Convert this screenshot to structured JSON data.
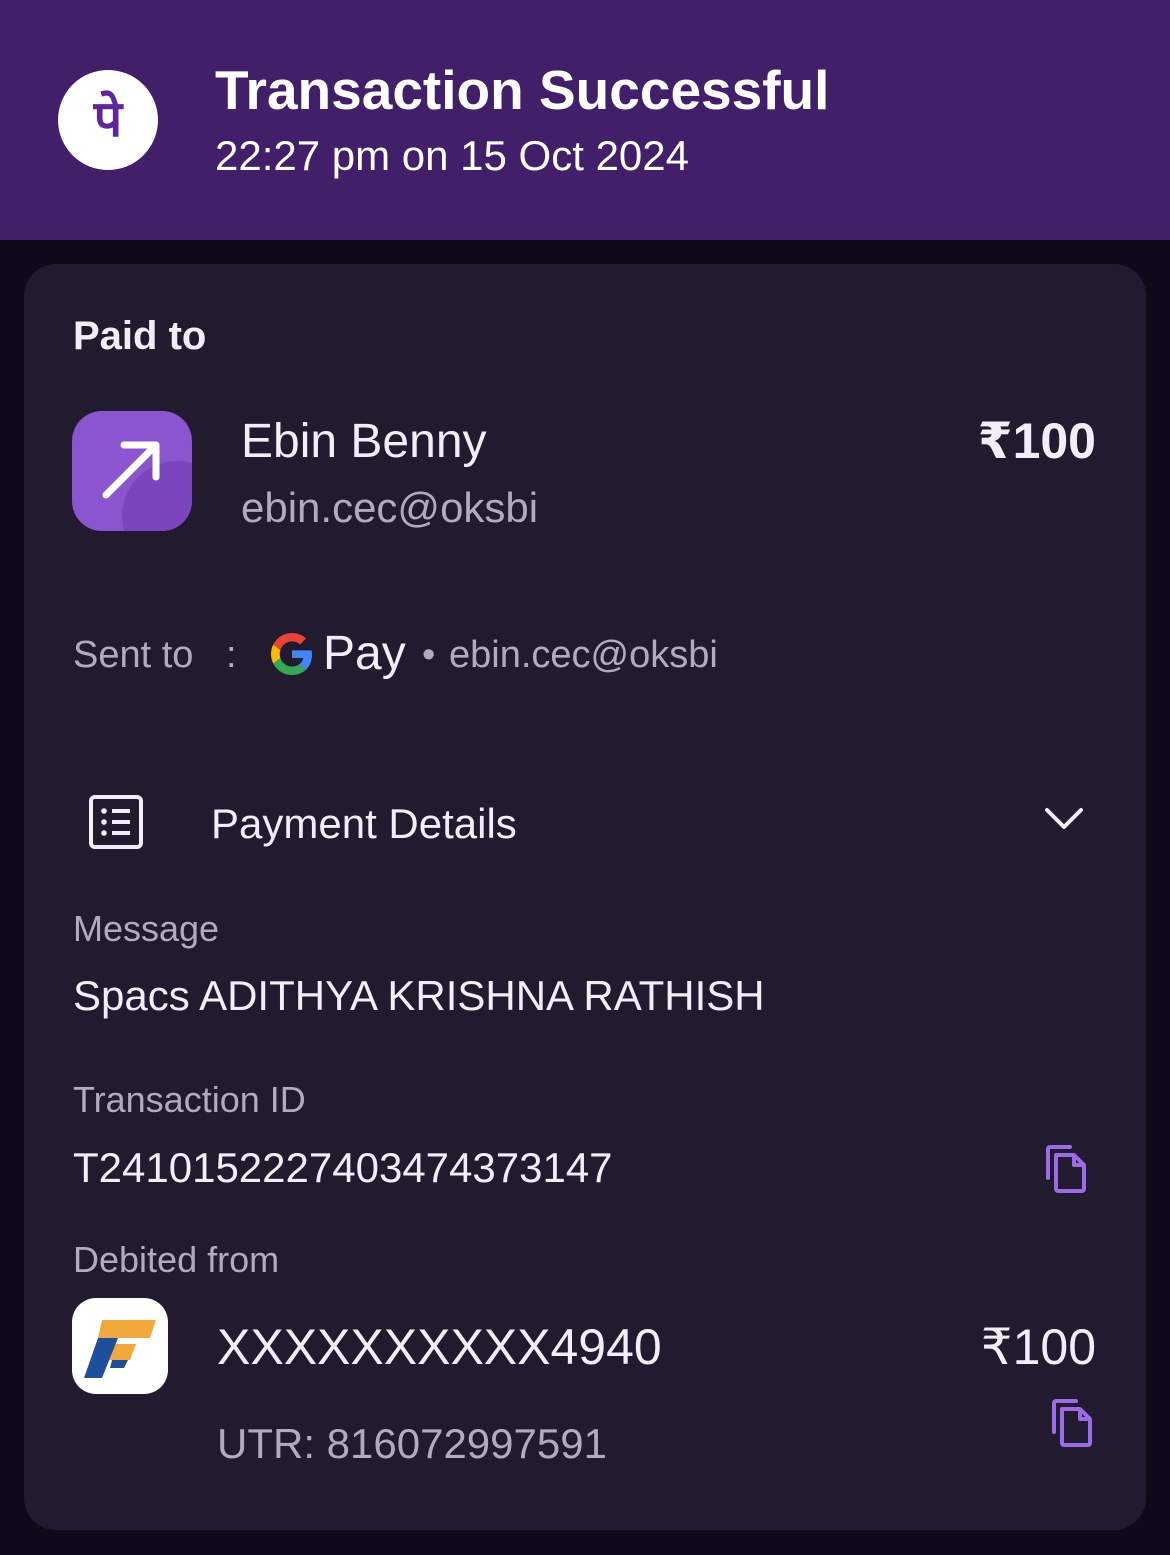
{
  "header": {
    "title": "Transaction Successful",
    "subtitle": "22:27 pm on 15 Oct 2024",
    "logo_glyph": "पे",
    "logo_icon": "phonepe-logo-icon"
  },
  "paid_to": {
    "label": "Paid to",
    "name": "Ebin  Benny",
    "upi_id": "ebin.cec@oksbi",
    "amount": "₹100",
    "icon": "arrow-up-right-icon"
  },
  "sent_to": {
    "label": "Sent to",
    "separator": ":",
    "app_name": "Pay",
    "app_icon": "google-g-icon",
    "dot": "•",
    "upi_id": "ebin.cec@oksbi"
  },
  "payment_details": {
    "label": "Payment Details",
    "icon": "list-icon",
    "toggle_icon": "chevron-down-icon"
  },
  "message": {
    "label": "Message",
    "value": "Spacs ADITHYA KRISHNA RATHISH"
  },
  "transaction": {
    "label": "Transaction ID",
    "value": "T2410152227403474373147",
    "copy_icon": "copy-icon"
  },
  "debited_from": {
    "label": "Debited from",
    "account": "XXXXXXXXXX4940",
    "amount": "₹100",
    "utr": "UTR: 816072997591",
    "bank_icon": "federal-bank-logo"
  },
  "colors": {
    "header_bg": "#421f69",
    "page_bg": "#0f0a1a",
    "card_bg": "#221b2f",
    "accent": "#9b6be8",
    "avatar": "#8a55cf"
  }
}
